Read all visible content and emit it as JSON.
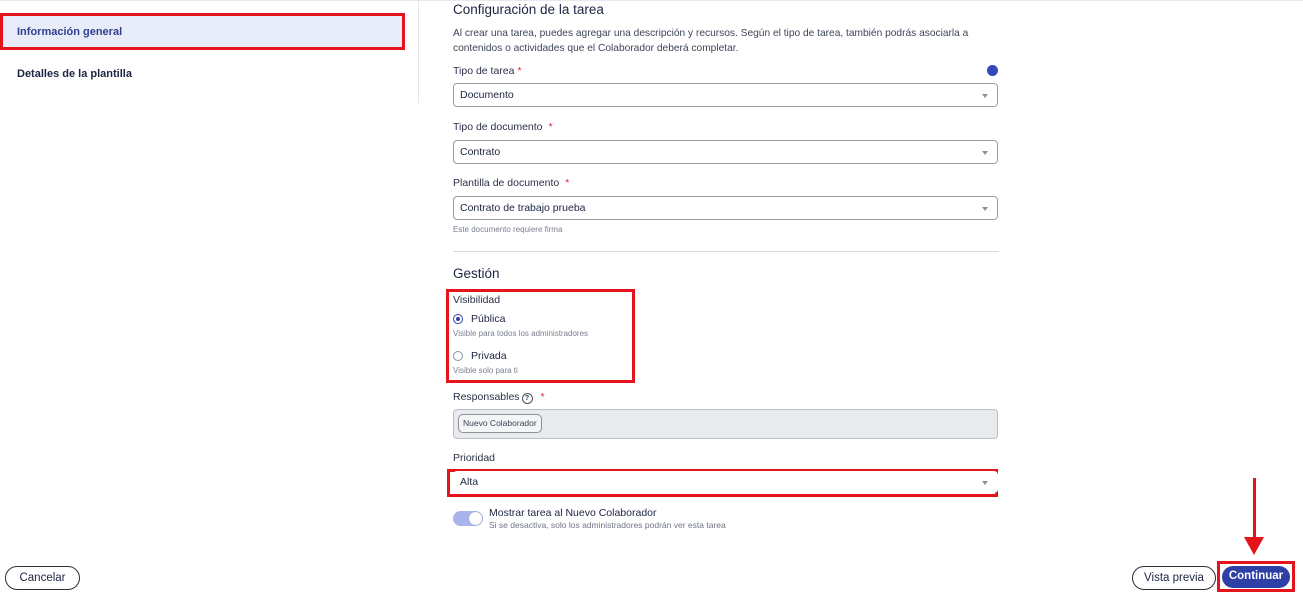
{
  "sidebar": {
    "items": [
      {
        "label": "Información general",
        "active": true
      },
      {
        "label": "Detalles de la plantilla",
        "active": false
      }
    ]
  },
  "config": {
    "title": "Configuración de la tarea",
    "description": "Al crear una tarea, puedes agregar una descripción y recursos. Según el tipo de tarea, también podrás asociarla a contenidos o actividades que el Colaborador deberá completar.",
    "task_type": {
      "label": "Tipo de tarea",
      "value": "Documento"
    },
    "document_type": {
      "label": "Tipo de documento",
      "value": "Contrato"
    },
    "document_template": {
      "label": "Plantilla de documento",
      "value": "Contrato de trabajo prueba",
      "helper": "Este documento requiere firma"
    }
  },
  "management": {
    "title": "Gestión",
    "visibility": {
      "label": "Visibilidad",
      "options": [
        {
          "label": "Pública",
          "helper": "Visible para todos los administradores",
          "selected": true
        },
        {
          "label": "Privada",
          "helper": "Visible solo para ti",
          "selected": false
        }
      ]
    },
    "responsibles": {
      "label": "Responsables",
      "help_glyph": "?",
      "chip": "Nuevo Colaborador"
    },
    "priority": {
      "label": "Prioridad",
      "value": "Alta"
    },
    "show_task": {
      "label": "Mostrar tarea al Nuevo Colaborador",
      "helper": "Si se desactiva, solo los administradores podrán ver esta tarea",
      "enabled": true
    }
  },
  "required_mark": "*",
  "footer": {
    "cancel": "Cancelar",
    "preview": "Vista previa",
    "continue": "Continuar"
  },
  "colors": {
    "primary": "#2e3fa6",
    "annotation": "#e3141b",
    "sidebar_active_bg": "#e8ecf8",
    "toggle_on": "#a9b5ea"
  },
  "icons": {
    "select_caret": "chevron-down-icon",
    "help": "question-circle-icon",
    "annotation_arrow": "arrow-down-icon"
  }
}
